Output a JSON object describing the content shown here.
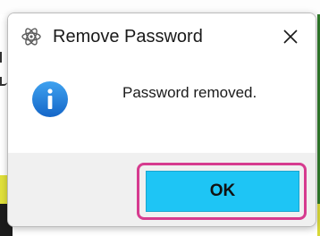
{
  "dialog": {
    "title": "Remove Password",
    "message": "Password removed.",
    "ok_label": "OK",
    "app_icon": "atom-icon",
    "close_icon": "close-icon",
    "message_icon": "info-icon"
  },
  "colors": {
    "ok_button": "#1ec5f5",
    "highlight": "#d63b8f",
    "info_icon": "#1e88e5",
    "footer": "#f0f0f0"
  }
}
